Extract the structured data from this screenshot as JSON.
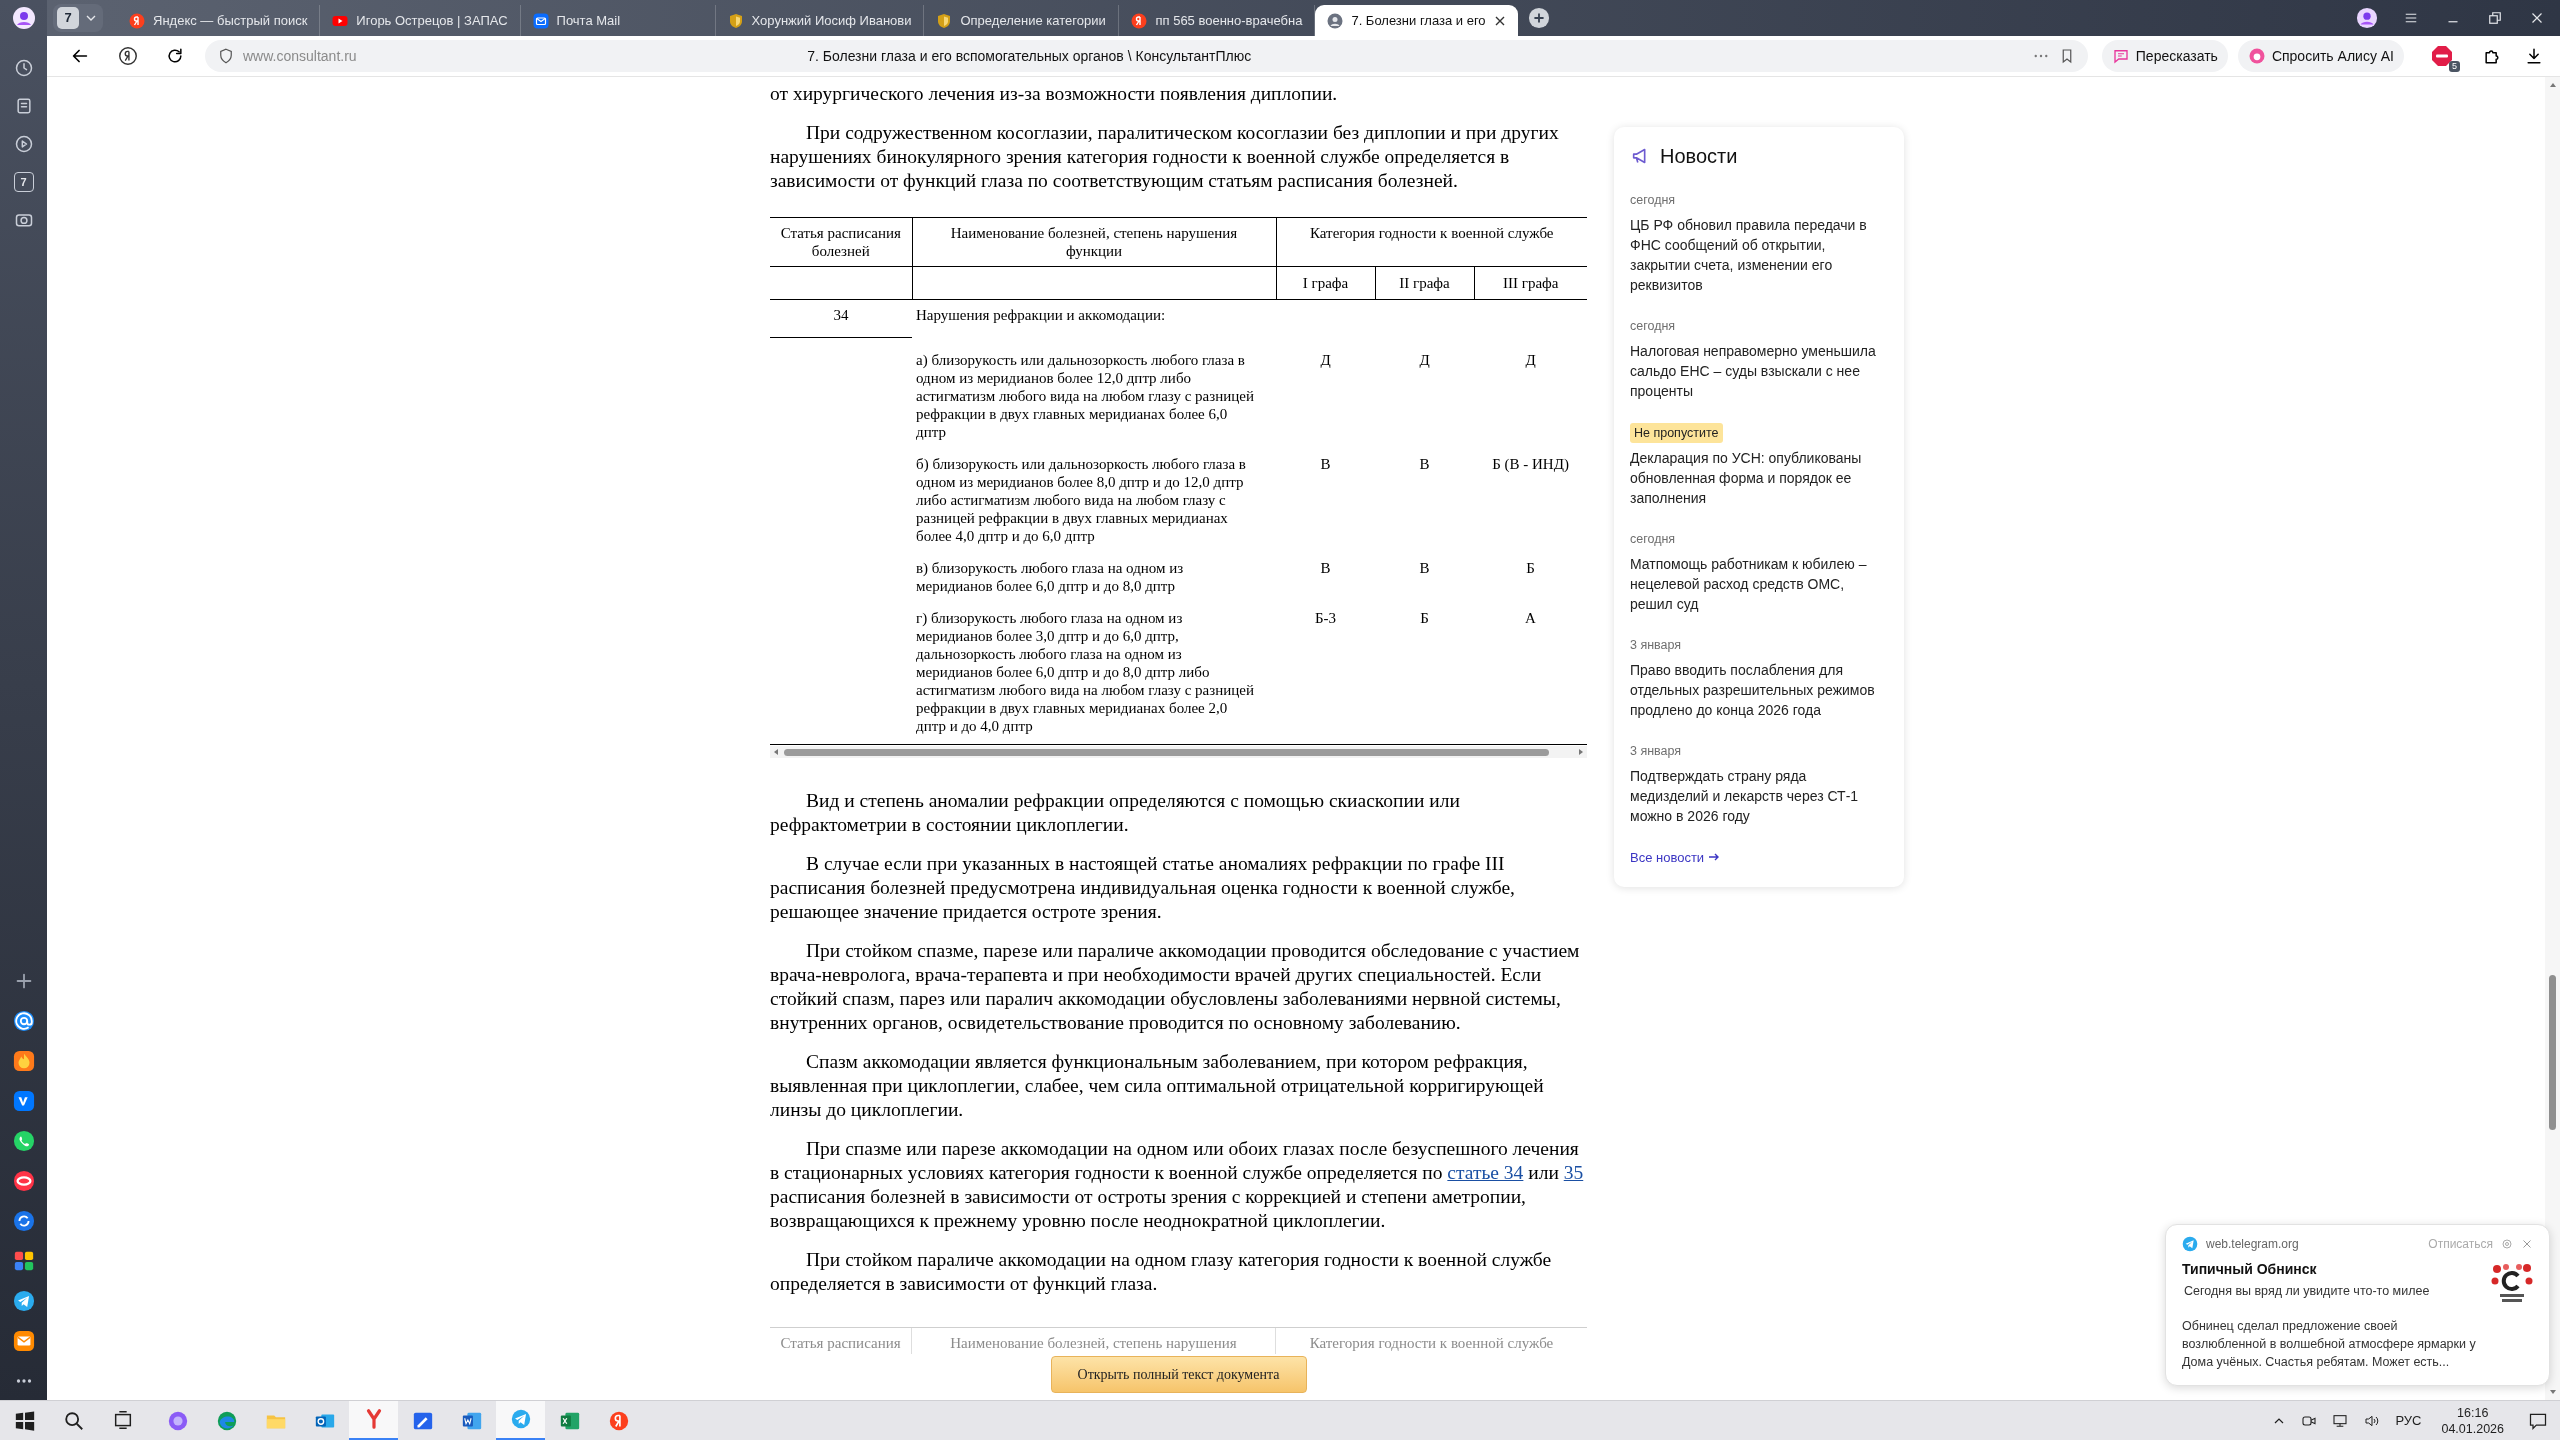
{
  "browser": {
    "tab_count": "7",
    "tabs": [
      {
        "kind": "yandex",
        "title": "Яндекс — быстрый поиск",
        "selected": false
      },
      {
        "kind": "video",
        "title": "Игорь Острецов | ЗАПАС",
        "selected": false
      },
      {
        "kind": "mail",
        "title": "Почта Mail",
        "selected": false
      },
      {
        "kind": "shield",
        "title": "Хорунжий Иосиф Иванови",
        "selected": false
      },
      {
        "kind": "shield",
        "title": "Определение категории",
        "selected": false
      },
      {
        "kind": "yandex",
        "title": "пп 565 военно-врачебна",
        "selected": false
      },
      {
        "kind": "avatar",
        "title": "7. Болезни глаза и его",
        "selected": true
      }
    ]
  },
  "address_bar": {
    "url": "www.consultant.ru",
    "page_title": "7. Болезни глаза и его вспомогательных органов \\ КонсультантПлюс",
    "retell_button": "Пересказать",
    "ask_button": "Спросить Алису AI",
    "adblock_count": "5"
  },
  "sidebar": {
    "day_button": "7"
  },
  "document": {
    "lead": "от хирургического лечения из-за возможности появления диплопии.",
    "intro": "При содружественном косоглазии, паралитическом косоглазии без диплопии и при других нарушениях бинокулярного зрения категория годности к военной службе определяется в зависимости от функций глаза по соответствующим статьям расписания болезней.",
    "table": {
      "header": {
        "article": "Статья расписания болезней",
        "name": "Наименование болезней, степень нарушения функции",
        "category": "Категория годности к военной службе",
        "grades": [
          "I графа",
          "II графа",
          "III графа"
        ]
      },
      "article": {
        "number": "34",
        "title": "Нарушения рефракции и аккомодации:"
      },
      "rows": [
        {
          "text": "а) близорукость или дальнозоркость любого глаза в одном из меридианов более 12,0 дптр либо астигматизм любого вида на любом глазу с разницей рефракции в двух главных меридианах более 6,0 дптр",
          "grades": [
            "Д",
            "Д",
            "Д"
          ]
        },
        {
          "text": "б) близорукость или дальнозоркость любого глаза в одном из меридианов более 8,0 дптр и до 12,0 дптр либо астигматизм любого вида на любом глазу с разницей рефракции в двух главных меридианах более 4,0 дптр и до 6,0 дптр",
          "grades": [
            "В",
            "В",
            "Б (В - ИНД)"
          ]
        },
        {
          "text": "в) близорукость любого глаза на одном из меридианов более 6,0 дптр и до 8,0 дптр",
          "grades": [
            "В",
            "В",
            "Б"
          ]
        },
        {
          "text": "г) близорукость любого глаза на одном из меридианов более 3,0 дптр и до 6,0 дптр, дальнозоркость любого глаза на одном из меридианов более 6,0 дптр и до 8,0 дптр либо астигматизм любого вида на любом глазу с разницей рефракции в двух главных меридианах более 2,0 дптр и до 4,0 дптр",
          "grades": [
            "Б-3",
            "Б",
            "А"
          ]
        }
      ]
    },
    "paragraphs": [
      {
        "segments": [
          {
            "kind": "text",
            "text": "Вид и степень аномалии рефракции определяются с помощью скиаскопии или рефрактометрии в состоянии циклоплегии."
          }
        ]
      },
      {
        "segments": [
          {
            "kind": "text",
            "text": "В случае если при указанных в настоящей статье аномалиях рефракции по графе III расписания болезней предусмотрена индивидуальная оценка годности к военной службе, решающее значение придается остроте зрения."
          }
        ]
      },
      {
        "segments": [
          {
            "kind": "text",
            "text": "При стойком спазме, парезе или параличе аккомодации проводится обследование с участием врача-невролога, врача-терапевта и при необходимости врачей других специальностей. Если стойкий спазм, парез или паралич аккомодации обусловлены заболеваниями нервной системы, внутренних органов, освидетельствование проводится по основному заболеванию."
          }
        ]
      },
      {
        "segments": [
          {
            "kind": "text",
            "text": "Спазм аккомодации является функциональным заболеванием, при котором рефракция, выявленная при циклоплегии, слабее, чем сила оптимальной отрицательной корригирующей линзы до циклоплегии."
          }
        ]
      },
      {
        "segments": [
          {
            "kind": "text",
            "text": "При спазме или парезе аккомодации на одном или обоих глазах после безуспешного лечения в стационарных условиях категория годности к военной службе определяется по "
          },
          {
            "kind": "link",
            "text": "статье 34"
          },
          {
            "kind": "text",
            "text": " или "
          },
          {
            "kind": "link",
            "text": "35"
          },
          {
            "kind": "text",
            "text": " расписания болезней в зависимости от остроты зрения с коррекцией и степени аметропии, возвращающихся к прежнему уровню после неоднократной циклоплегии."
          }
        ]
      },
      {
        "segments": [
          {
            "kind": "text",
            "text": "При стойком параличе аккомодации на одном глазу категория годности к военной службе определяется в зависимости от функций глаза."
          }
        ]
      }
    ],
    "faded_header": [
      "Статья расписания",
      "Наименование болезней, степень нарушения",
      "Категория годности к военной службе"
    ],
    "open_button": "Открыть полный текст документа"
  },
  "news": {
    "title": "Новости",
    "items": [
      {
        "kind": "date",
        "label": "сегодня",
        "headline": "ЦБ РФ обновил правила передачи в ФНС сообщений об открытии, закрытии счета, изменении его реквизитов"
      },
      {
        "kind": "date",
        "label": "сегодня",
        "headline": "Налоговая неправомерно уменьшила сальдо ЕНС – суды взыскали с нее проценты"
      },
      {
        "kind": "badge",
        "label": "Не пропустите",
        "headline": "Декларация по УСН: опубликованы обновленная форма и порядок ее заполнения"
      },
      {
        "kind": "date",
        "label": "сегодня",
        "headline": "Матпомощь работникам к юбилею – нецелевой расход средств ОМС, решил суд"
      },
      {
        "kind": "date",
        "label": "3 января",
        "headline": "Право вводить послабления для отдельных разрешительных режимов продлено до конца 2026 года"
      },
      {
        "kind": "date",
        "label": "3 января",
        "headline": "Подтверждать страну ряда медизделий и лекарств через СТ-1 можно в 2026 году"
      }
    ],
    "all_link": "Все новости"
  },
  "notification": {
    "site": "web.telegram.org",
    "unsubscribe": "Отписаться",
    "title": "Типичный Обнинск",
    "subtitle": "Сегодня вы вряд ли увидите что-то милее",
    "body": "Обнинец сделал предложение своей возлюбленной в волшебной атмосфере ярмарки у Дома учёных. Счастья ребятам. Может есть..."
  },
  "taskbar": {
    "apps": [
      {
        "kind": "assistant",
        "active": false
      },
      {
        "kind": "edge",
        "active": false
      },
      {
        "kind": "folder",
        "active": false
      },
      {
        "kind": "outlook",
        "active": false
      },
      {
        "kind": "browser",
        "active": true
      },
      {
        "kind": "editor",
        "active": false
      },
      {
        "kind": "word",
        "active": false
      },
      {
        "kind": "telegram",
        "active": true
      },
      {
        "kind": "excel",
        "active": false
      },
      {
        "kind": "yandex",
        "active": false
      }
    ],
    "language": "РУС",
    "time": "16:16",
    "date": "04.01.2026"
  }
}
